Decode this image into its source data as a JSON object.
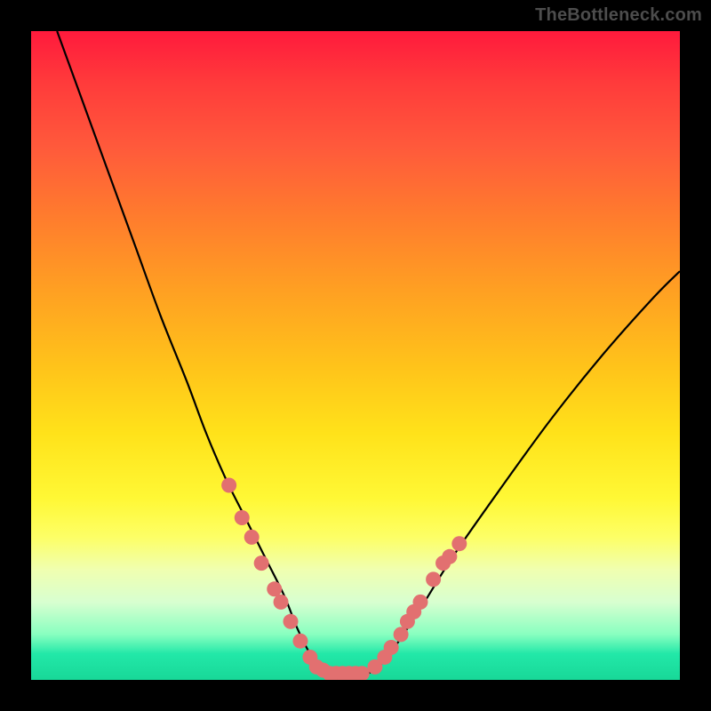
{
  "watermark": "TheBottleneck.com",
  "colors": {
    "curve": "#000000",
    "marker_fill": "#e27070",
    "marker_stroke": "#c95a5a",
    "background": "#000000"
  },
  "chart_data": {
    "type": "line",
    "title": "",
    "xlabel": "",
    "ylabel": "",
    "xlim": [
      0,
      100
    ],
    "ylim": [
      0,
      100
    ],
    "grid": false,
    "series": [
      {
        "name": "bottleneck-curve",
        "x": [
          4,
          8,
          12,
          16,
          20,
          24,
          27,
          30,
          33,
          36,
          39,
          41,
          43,
          44.5,
          46,
          48,
          50,
          52,
          54,
          56,
          60,
          65,
          72,
          80,
          88,
          96,
          100
        ],
        "values": [
          100,
          89,
          78,
          67,
          56,
          46,
          38,
          31,
          25,
          19,
          13,
          8,
          4,
          2,
          1,
          0.5,
          0.5,
          1,
          2.5,
          5,
          11,
          19,
          29,
          40,
          50,
          59,
          63
        ]
      }
    ],
    "markers": [
      {
        "x": 30.5,
        "y": 30
      },
      {
        "x": 32.5,
        "y": 25
      },
      {
        "x": 34.0,
        "y": 22
      },
      {
        "x": 35.5,
        "y": 18
      },
      {
        "x": 37.5,
        "y": 14
      },
      {
        "x": 38.5,
        "y": 12
      },
      {
        "x": 40.0,
        "y": 9
      },
      {
        "x": 41.5,
        "y": 6
      },
      {
        "x": 43.0,
        "y": 3.5
      },
      {
        "x": 44.0,
        "y": 2
      },
      {
        "x": 45.0,
        "y": 1.5
      },
      {
        "x": 46.0,
        "y": 1
      },
      {
        "x": 47.0,
        "y": 1
      },
      {
        "x": 48.0,
        "y": 1
      },
      {
        "x": 49.0,
        "y": 1
      },
      {
        "x": 50.0,
        "y": 1
      },
      {
        "x": 51.0,
        "y": 1
      },
      {
        "x": 53.0,
        "y": 2
      },
      {
        "x": 54.5,
        "y": 3.5
      },
      {
        "x": 55.5,
        "y": 5
      },
      {
        "x": 57.0,
        "y": 7
      },
      {
        "x": 58.0,
        "y": 9
      },
      {
        "x": 59.0,
        "y": 10.5
      },
      {
        "x": 60.0,
        "y": 12
      },
      {
        "x": 62.0,
        "y": 15.5
      },
      {
        "x": 63.5,
        "y": 18
      },
      {
        "x": 64.5,
        "y": 19
      },
      {
        "x": 66.0,
        "y": 21
      }
    ]
  }
}
